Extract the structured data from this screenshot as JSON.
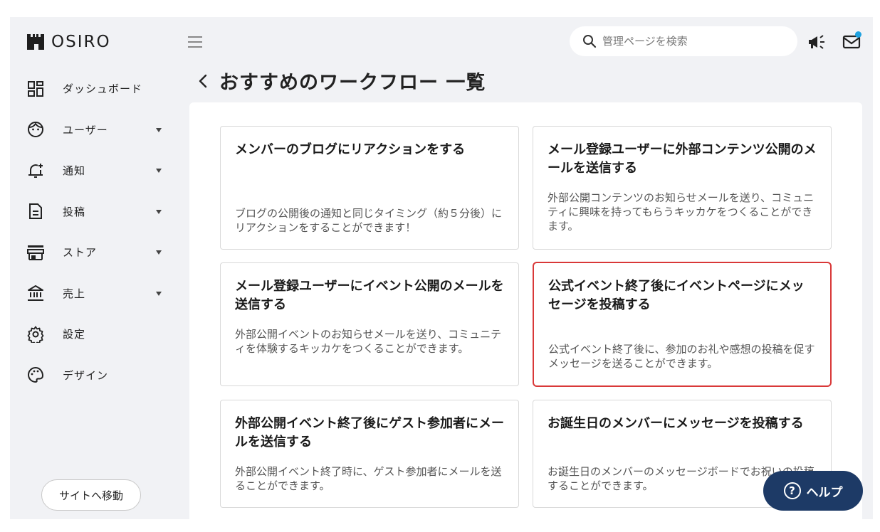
{
  "brand": {
    "name": "OSIRO"
  },
  "header": {
    "search_placeholder": "管理ページを検索",
    "icons": [
      "menu-icon",
      "search-icon",
      "megaphone-icon",
      "mail-icon"
    ],
    "notification_dot_color": "#1fa2e0"
  },
  "sidebar": {
    "items": [
      {
        "label": "ダッシュボード",
        "icon": "dashboard-icon",
        "has_caret": false
      },
      {
        "label": "ユーザー",
        "icon": "user-face-icon",
        "has_caret": true
      },
      {
        "label": "通知",
        "icon": "bell-icon",
        "has_caret": true
      },
      {
        "label": "投稿",
        "icon": "document-icon",
        "has_caret": true
      },
      {
        "label": "ストア",
        "icon": "store-icon",
        "has_caret": true
      },
      {
        "label": "売上",
        "icon": "bank-icon",
        "has_caret": true
      },
      {
        "label": "設定",
        "icon": "gear-icon",
        "has_caret": false
      },
      {
        "label": "デザイン",
        "icon": "palette-icon",
        "has_caret": false
      }
    ],
    "site_button": "サイトへ移動"
  },
  "page": {
    "title": "おすすめのワークフロー 一覧",
    "back_icon": "chevron-left-icon"
  },
  "cards": [
    {
      "title": "メンバーのブログにリアクションをする",
      "description": "ブログの公開後の通知と同じタイミング（約５分後）にリアクションをすることができます！"
    },
    {
      "title": "メール登録ユーザーに外部コンテンツ公開のメールを送信する",
      "description": "外部公開コンテンツのお知らせメールを送り、コミュニティに興味を持ってもらうキッカケをつくることができます。"
    },
    {
      "title": "メール登録ユーザーにイベント公開のメールを送信する",
      "description": "外部公開イベントのお知らせメールを送り、コミュニティを体験するキッカケをつくることができます。"
    },
    {
      "title": "公式イベント終了後にイベントページにメッセージを投稿する",
      "description": "公式イベント終了後に、参加のお礼や感想の投稿を促すメッセージを送ることができます。",
      "selected": true
    },
    {
      "title": "外部公開イベント終了後にゲスト参加者にメールを送信する",
      "description": "外部公開イベント終了時に、ゲスト参加者にメールを送ることができます。"
    },
    {
      "title": "お誕生日のメンバーにメッセージを投稿する",
      "description": "お誕生日のメンバーのメッセージボードでお祝いの投稿することができます。"
    }
  ],
  "help_button": {
    "label": "ヘルプ",
    "icon": "question-circle-icon"
  },
  "colors": {
    "background": "#f1f2f5",
    "selected_border": "#d93838",
    "help_bg": "#1d3a66"
  }
}
